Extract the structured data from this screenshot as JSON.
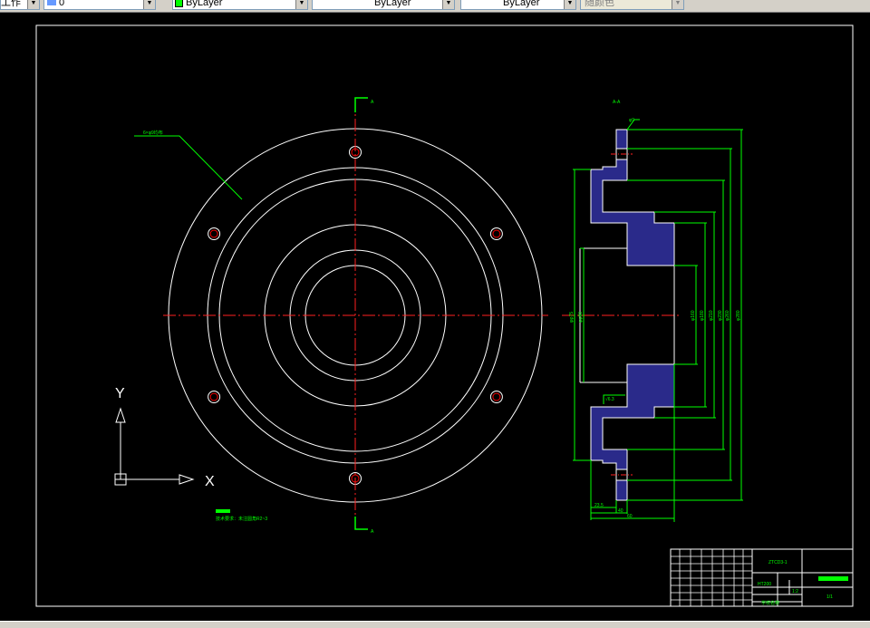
{
  "toolbar": {
    "workspace_label": "工作",
    "layer_value": "0",
    "color_value": "ByLayer",
    "linetype_value": "ByLayer",
    "lineweight_value": "ByLayer",
    "plotstyle_value": "随颜色"
  },
  "drawing": {
    "front_view_label": "6×φ9均布",
    "section_label": "A-A",
    "section_mark_top": "A",
    "section_mark_bottom": "A",
    "ucs": {
      "y_label": "Y",
      "x_label": "X"
    },
    "tech_note": "技术要求：未注圆角R2~3",
    "surface_mark": "√6.3",
    "dim_labels": {
      "top_small": "φ9",
      "left_1": "φφ75",
      "left_2": "φφ90",
      "r1": "φ160",
      "r2": "φ180",
      "r3": "φ210",
      "r4": "φ230",
      "r5": "φ260",
      "r6": "φ280",
      "bottom_1": "23.5",
      "bottom_2": "40",
      "bottom_3": "60"
    },
    "title_block": {
      "drawing_no": "ZTCD3-1",
      "scale": "1:2",
      "sheet": "1/1",
      "material": "HT200",
      "company": "学校名称"
    }
  },
  "colors": {
    "background": "#000000",
    "border": "#ffffff",
    "outline": "#ffffff",
    "centerline": "#ff2020",
    "dimension": "#00ff00",
    "hatch": "#2a2a8a",
    "holes": "#ff0000"
  }
}
